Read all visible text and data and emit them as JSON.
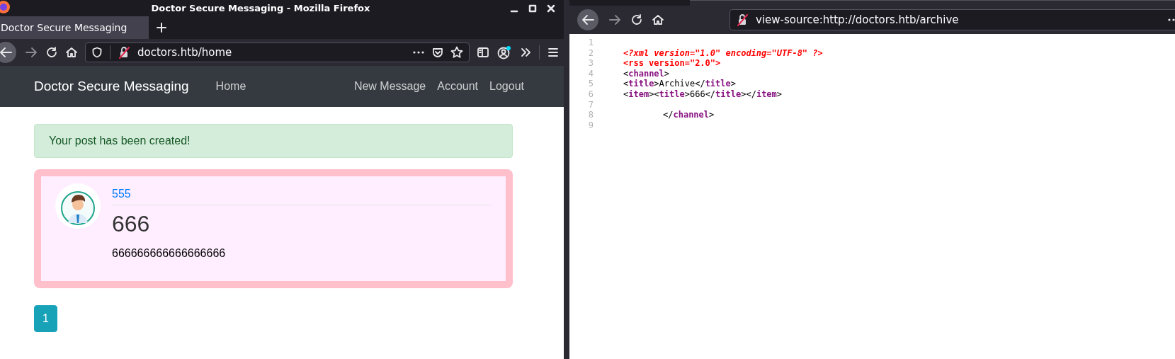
{
  "left_window": {
    "title": "Doctor Secure Messaging - Mozilla Firefox",
    "tabs": [
      {
        "label": "Doctor Secure Messaging",
        "selected": true
      }
    ],
    "url": "doctors.htb/home",
    "navbar": {
      "brand": "Doctor Secure Messaging",
      "links": [
        "Home"
      ],
      "right_links": [
        "New Message",
        "Account",
        "Logout"
      ]
    },
    "alert": "Your post has been created!",
    "posts": [
      {
        "author": "555",
        "title": "666",
        "content": "666666666666666666"
      }
    ],
    "pagination": [
      {
        "label": "1",
        "selected": true
      }
    ]
  },
  "right_window": {
    "url": "view-source:http://doctors.htb/archive",
    "source_lines": [
      {
        "number": "1"
      },
      {
        "number": "2",
        "indented": false,
        "tokens": [
          {
            "kind": "pi",
            "text": "<?xml version=\"1.0\" encoding=\"UTF-8\" ?>"
          }
        ]
      },
      {
        "number": "3",
        "indented": false,
        "tokens": [
          {
            "kind": "doctype",
            "text": "<rss version=\"2.0\">"
          }
        ]
      },
      {
        "number": "4",
        "indented": false,
        "tokens": [
          {
            "kind": "bracket",
            "text": "<"
          },
          {
            "kind": "tag",
            "text": "channel"
          },
          {
            "kind": "bracket",
            "text": ">"
          }
        ]
      },
      {
        "number": "5",
        "indented": false,
        "tokens": [
          {
            "kind": "bracket",
            "text": "<"
          },
          {
            "kind": "tag",
            "text": "title"
          },
          {
            "kind": "bracket",
            "text": ">"
          },
          {
            "kind": "text",
            "text": "Archive"
          },
          {
            "kind": "bracket",
            "text": "</"
          },
          {
            "kind": "tag",
            "text": "title"
          },
          {
            "kind": "bracket",
            "text": ">"
          }
        ]
      },
      {
        "number": "6",
        "indented": false,
        "tokens": [
          {
            "kind": "bracket",
            "text": "<"
          },
          {
            "kind": "tag",
            "text": "item"
          },
          {
            "kind": "bracket",
            "text": "><"
          },
          {
            "kind": "tag",
            "text": "title"
          },
          {
            "kind": "bracket",
            "text": ">"
          },
          {
            "kind": "text",
            "text": "666"
          },
          {
            "kind": "bracket",
            "text": "</"
          },
          {
            "kind": "tag",
            "text": "title"
          },
          {
            "kind": "bracket",
            "text": "></"
          },
          {
            "kind": "tag",
            "text": "item"
          },
          {
            "kind": "bracket",
            "text": ">"
          }
        ]
      },
      {
        "number": "7"
      },
      {
        "number": "8",
        "indented": true,
        "tokens": [
          {
            "kind": "bracket",
            "text": "</"
          },
          {
            "kind": "tag",
            "text": "channel"
          },
          {
            "kind": "bracket",
            "text": ">"
          }
        ]
      },
      {
        "number": "9"
      }
    ]
  }
}
